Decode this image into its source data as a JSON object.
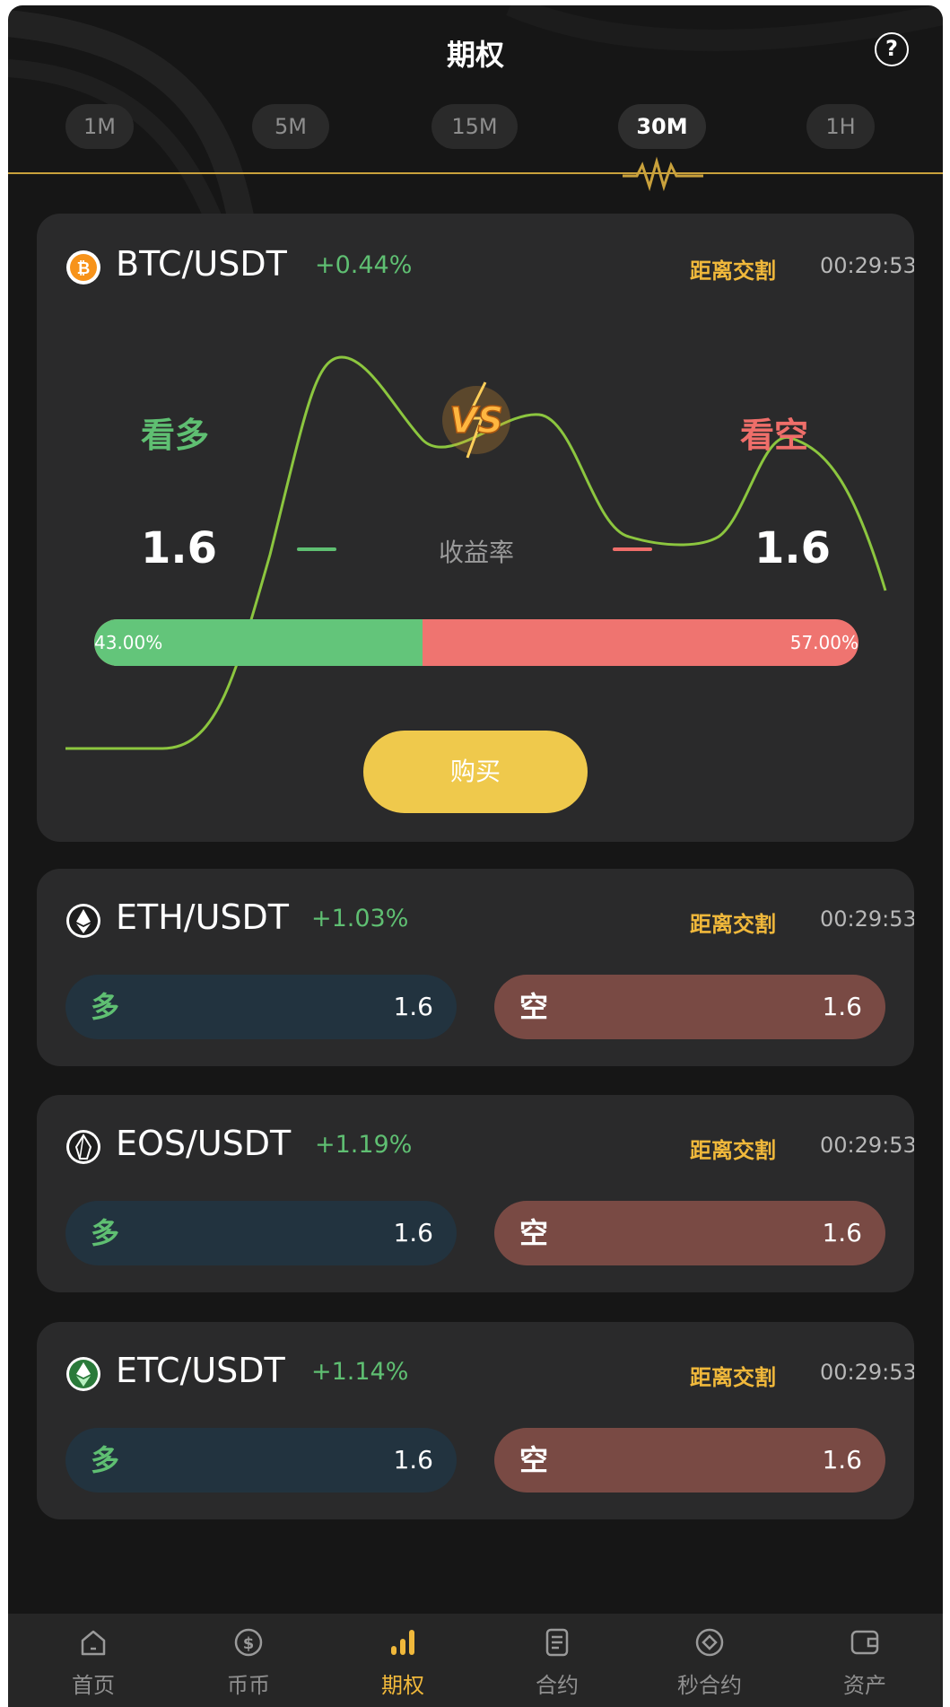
{
  "header": {
    "title": "期权",
    "help_icon": "question-circle-icon",
    "help_symbol": "?"
  },
  "tabs": [
    {
      "label": "1M",
      "active": false
    },
    {
      "label": "5M",
      "active": false
    },
    {
      "label": "15M",
      "active": false
    },
    {
      "label": "30M",
      "active": true
    },
    {
      "label": "1H",
      "active": false
    }
  ],
  "featured": {
    "pair": "BTC/USDT",
    "change": "+0.44%",
    "delivery_label": "距离交割",
    "countdown": "00:29:53",
    "icon": "bitcoin-icon",
    "long_label": "看多",
    "short_label": "看空",
    "long_rate": "1.6",
    "short_rate": "1.6",
    "rate_label": "收益率",
    "long_ratio": "43.00%",
    "short_ratio": "57.00%",
    "long_ratio_value": 0.43,
    "buy_label": "购买",
    "vs_badge": "VS"
  },
  "markets": [
    {
      "pair": "ETH/USDT",
      "change": "+1.03%",
      "delivery_label": "距离交割",
      "countdown": "00:29:53",
      "icon": "ethereum-icon",
      "long_label": "多",
      "long_value": "1.6",
      "short_label": "空",
      "short_value": "1.6"
    },
    {
      "pair": "EOS/USDT",
      "change": "+1.19%",
      "delivery_label": "距离交割",
      "countdown": "00:29:53",
      "icon": "eos-icon",
      "long_label": "多",
      "long_value": "1.6",
      "short_label": "空",
      "short_value": "1.6"
    },
    {
      "pair": "ETC/USDT",
      "change": "+1.14%",
      "delivery_label": "距离交割",
      "countdown": "00:29:53",
      "icon": "ethereum-classic-icon",
      "long_label": "多",
      "long_value": "1.6",
      "short_label": "空",
      "short_value": "1.6"
    }
  ],
  "nav": [
    {
      "label": "首页",
      "icon": "home-icon",
      "active": false
    },
    {
      "label": "币币",
      "icon": "dollar-coin-icon",
      "active": false
    },
    {
      "label": "期权",
      "icon": "bar-chart-icon",
      "active": true
    },
    {
      "label": "合约",
      "icon": "document-icon",
      "active": false
    },
    {
      "label": "秒合约",
      "icon": "diamond-circle-icon",
      "active": false
    },
    {
      "label": "资产",
      "icon": "wallet-icon",
      "active": false
    }
  ],
  "colors": {
    "long": "#5fbf72",
    "short": "#ef6e6a",
    "accent_gold": "#f0b83b",
    "buy_button": "#efc94c",
    "card_bg": "#2a2a2b"
  }
}
